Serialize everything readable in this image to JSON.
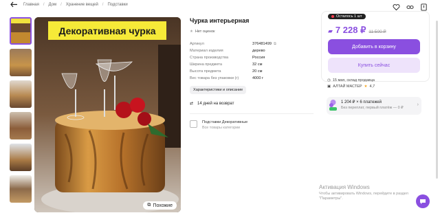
{
  "breadcrumbs": [
    "Главная",
    "Дом",
    "Хранение вещей",
    "Подставки"
  ],
  "header_icons": [
    "heart-icon",
    "share-link-icon",
    "bookmark-icon"
  ],
  "image": {
    "banner_text": "Декоративная чурка",
    "similar_label": "Похожие",
    "thumbnails_count": 6
  },
  "product": {
    "title": "Чурка интерьерная",
    "rating_text": "Нет оценок",
    "specs": [
      {
        "key": "Артикул",
        "value": "376481499"
      },
      {
        "key": "Материал изделия",
        "value": "дерево"
      },
      {
        "key": "Страна производства",
        "value": "Россия"
      },
      {
        "key": "Ширина предмета",
        "value": "32 см"
      },
      {
        "key": "Высота предмета",
        "value": "20 см"
      },
      {
        "key": "Вес товара без упаковки (г)",
        "value": "4000 г"
      }
    ],
    "chars_button": "Характеристики и описание",
    "return_text": "14 дней на возврат",
    "brand": {
      "title": "Подставки Декоративные",
      "subtitle": "Все товары категории"
    }
  },
  "buy": {
    "stock_badge": "Осталось 1 шт",
    "price": "7 228 ₽",
    "old_price": "11 500 ₽",
    "cart_button": "Добавить в корзину",
    "buy_now_button": "Купить сейчас",
    "delivery_line": "15 мая, склад продавца",
    "seller": "АЛТАЙ МАСТЕР",
    "seller_rating": "4,7",
    "installment": {
      "line1": "1 204 ₽ × 6 платежей",
      "line2": "Без переплат, первый платёж — 0 ₽"
    }
  },
  "windows": {
    "title": "Активация Windows",
    "subtitle": "Чтобы активировать Windows, перейдите в раздел \"Параметры\"."
  },
  "colors": {
    "accent": "#8a4fe0",
    "banner": "#f6ea38"
  }
}
